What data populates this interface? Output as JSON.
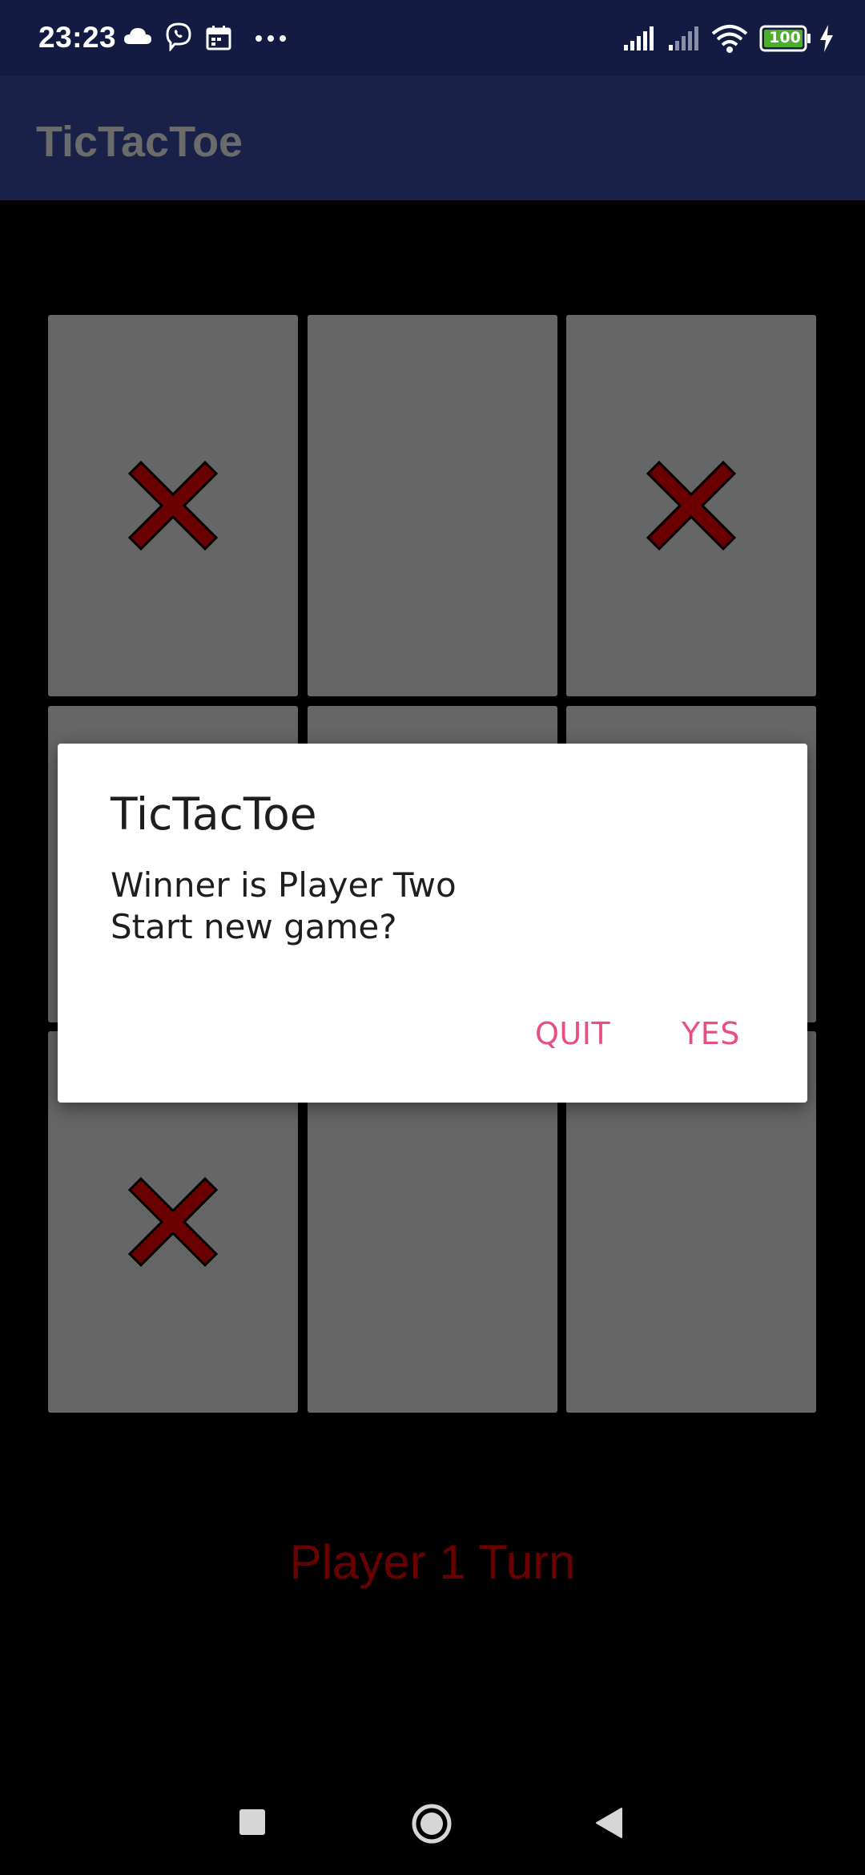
{
  "status_bar": {
    "time": "23:23",
    "icons": [
      "cloud-icon",
      "viber-icon",
      "calendar-icon",
      "more-dots-icon"
    ],
    "right_icons": [
      "signal-icon",
      "signal-icon",
      "wifi-icon",
      "battery-icon",
      "charging-icon"
    ],
    "battery_level": "100"
  },
  "app": {
    "title": "TicTacToe"
  },
  "board": {
    "cells": [
      "X",
      "",
      "X",
      "",
      "",
      "",
      "X",
      "",
      ""
    ],
    "x_color": "#6b0000",
    "cell_color": "#666666"
  },
  "turn_label": "Player 1 Turn",
  "dialog": {
    "title": "TicTacToe",
    "message_line1": "Winner is Player Two",
    "message_line2": "Start new game?",
    "quit_label": "QUIT",
    "yes_label": "YES",
    "accent": "#e84d86"
  },
  "nav_bar": {
    "icons": [
      "recents-square-icon",
      "home-circle-icon",
      "back-triangle-icon"
    ]
  }
}
